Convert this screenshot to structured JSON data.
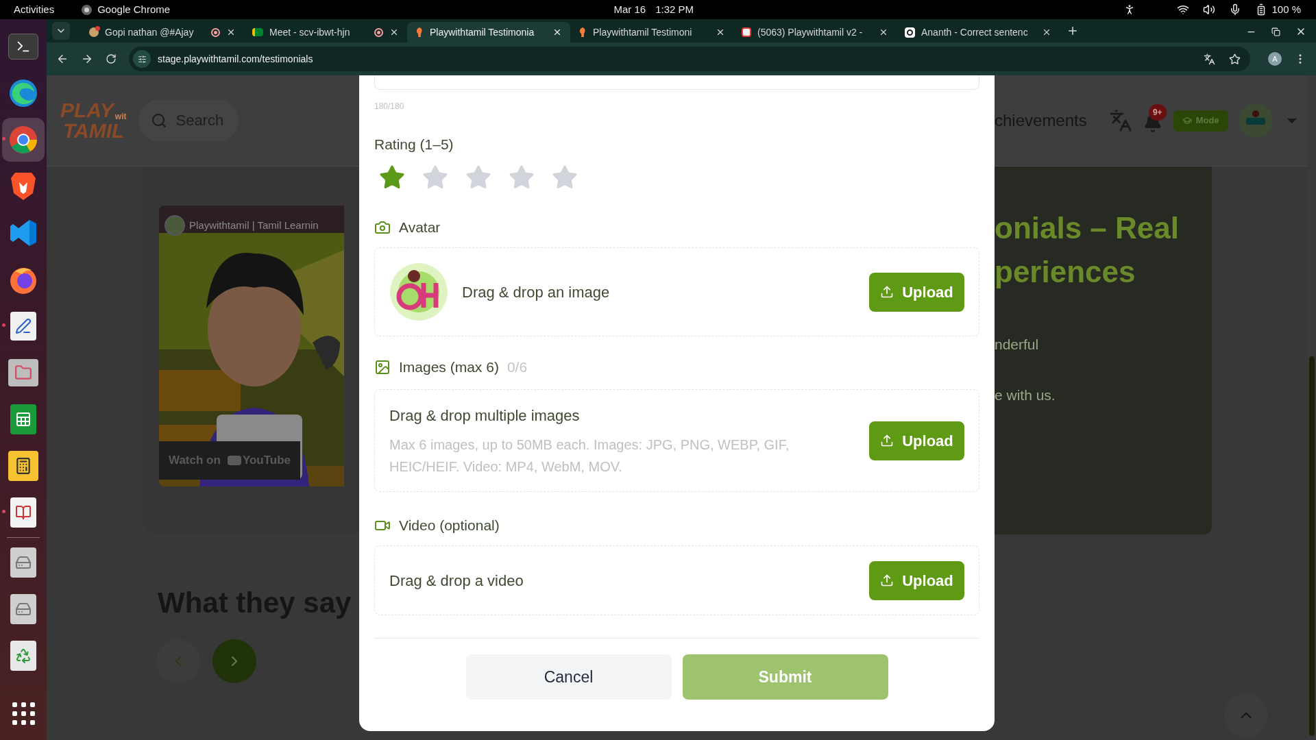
{
  "system_bar": {
    "activities": "Activities",
    "app_name": "Google Chrome",
    "date": "Mar 16",
    "time": "1:32 PM",
    "battery": "100 %"
  },
  "dock": [
    {
      "kind": "terminal",
      "selected": false,
      "running": false
    },
    {
      "kind": "edge",
      "selected": false,
      "running": false
    },
    {
      "kind": "chrome",
      "selected": true,
      "running": true
    },
    {
      "kind": "brave",
      "selected": false,
      "running": false
    },
    {
      "kind": "code",
      "selected": false,
      "running": false
    },
    {
      "kind": "firefox",
      "selected": false,
      "running": false
    },
    {
      "kind": "editor",
      "selected": false,
      "running": true
    },
    {
      "kind": "files",
      "selected": false,
      "running": false
    },
    {
      "kind": "sheet",
      "selected": false,
      "running": false
    },
    {
      "kind": "calculator",
      "selected": false,
      "running": false
    },
    {
      "kind": "reader",
      "selected": false,
      "running": true
    },
    {
      "kind": "drive",
      "selected": false,
      "running": false
    },
    {
      "kind": "drive",
      "selected": false,
      "running": false
    },
    {
      "kind": "trash",
      "selected": false,
      "running": false
    }
  ],
  "browser": {
    "tabs": [
      {
        "kind": "chat",
        "title": "Gopi nathan @#Ajay",
        "selected": false,
        "recording": true
      },
      {
        "kind": "meet",
        "title": "Meet - scv-ibwt-hjn",
        "selected": false,
        "recording": true
      },
      {
        "kind": "site",
        "title": "Playwithtamil Testimonia",
        "selected": true,
        "recording": false
      },
      {
        "kind": "site",
        "title": "Playwithtamil Testimoni",
        "selected": false,
        "recording": false
      },
      {
        "kind": "app",
        "title": "(5063) Playwithtamil v2 -",
        "selected": false,
        "recording": false
      },
      {
        "kind": "ai",
        "title": "Ananth - Correct sentenc",
        "selected": false,
        "recording": false
      }
    ],
    "url": "stage.playwithtamil.com/testimonials",
    "profile": "A"
  },
  "page": {
    "logo": {
      "top": "PLAY",
      "middle": "wit",
      "bottom": "TAMIL"
    },
    "search": {
      "placeholder": "Search"
    },
    "nav_item": "chievements",
    "notifications": "9+",
    "mode_button": "Mode",
    "video": {
      "title": "Playwithtamil | Tamil Learnin",
      "watch_on": "Watch on",
      "platform": "YouTube"
    },
    "hero_title_lines": [
      "onials – Real",
      "periences"
    ],
    "hero_text_lines": [
      "nderful",
      "e with us."
    ],
    "section_title": "What they say"
  },
  "modal": {
    "char_count": "180/180",
    "rating": {
      "label": "Rating (1–5)",
      "stars": 1
    },
    "sections": [
      {
        "kind": "avatar",
        "label": "Avatar",
        "drop_title": "Drag & drop an image",
        "upload": "Upload"
      },
      {
        "kind": "images",
        "label": "Images (max 6)",
        "count": "0/6",
        "drop_title": "Drag & drop multiple images",
        "hint": "Max 6 images, up to 50MB each. Images: JPG, PNG, WEBP, GIF, HEIC/HEIF. Video: MP4, WebM, MOV.",
        "upload": "Upload"
      },
      {
        "kind": "video",
        "label": "Video (optional)",
        "drop_title": "Drag & drop a video",
        "upload": "Upload"
      }
    ],
    "cancel": "Cancel",
    "submit": {
      "label": "Submit",
      "disabled": true
    }
  }
}
